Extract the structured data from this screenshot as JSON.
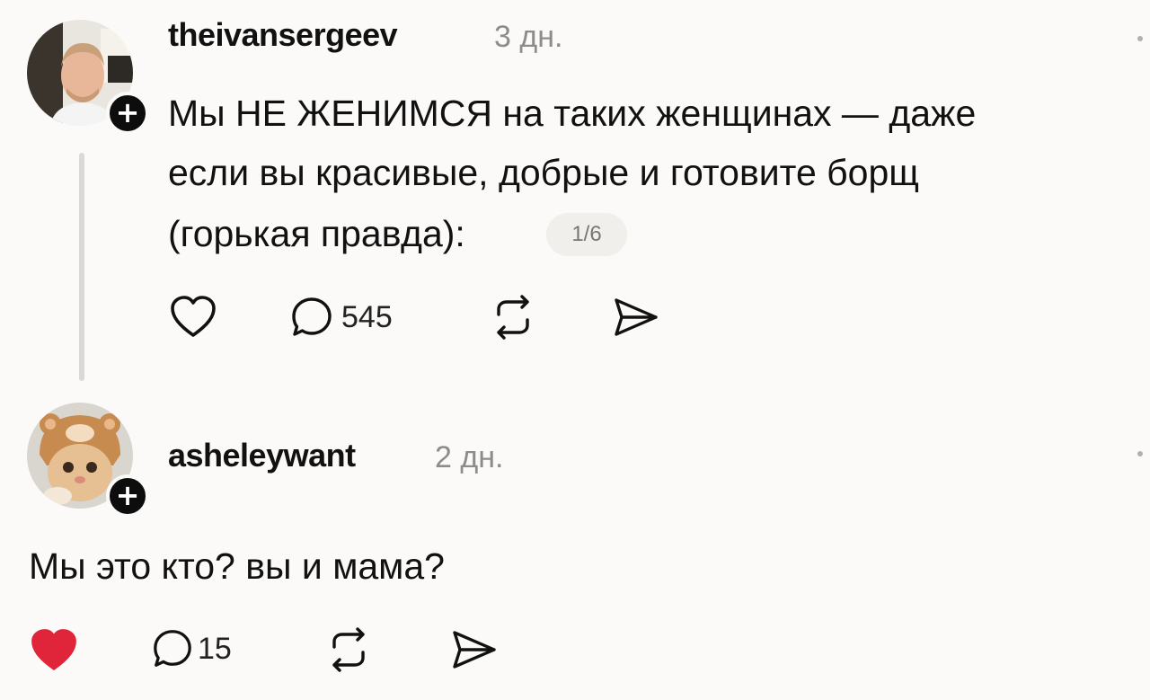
{
  "posts": [
    {
      "username": "theivansergeev",
      "time": "3 дн.",
      "text_lines": [
        "Мы НЕ ЖЕНИМСЯ на таких женщинах — даже",
        "если вы красивые, добрые и готовите борщ",
        "(горькая правда):"
      ],
      "counter": "1/6",
      "reply_count": "545",
      "liked": false
    },
    {
      "username": "asheleywant",
      "time": "2 дн.",
      "text": "Мы это кто? вы и мама?",
      "reply_count": "15",
      "liked": true
    }
  ],
  "colors": {
    "background": "#fbfaf8",
    "text": "#111111",
    "muted": "#8c8c8c",
    "like_active": "#e0245e",
    "thread_line": "#d9d9d9"
  },
  "icons": {
    "like": "heart-icon",
    "reply": "speech-bubble-icon",
    "repost": "repost-icon",
    "share": "send-icon",
    "follow": "plus-icon"
  }
}
